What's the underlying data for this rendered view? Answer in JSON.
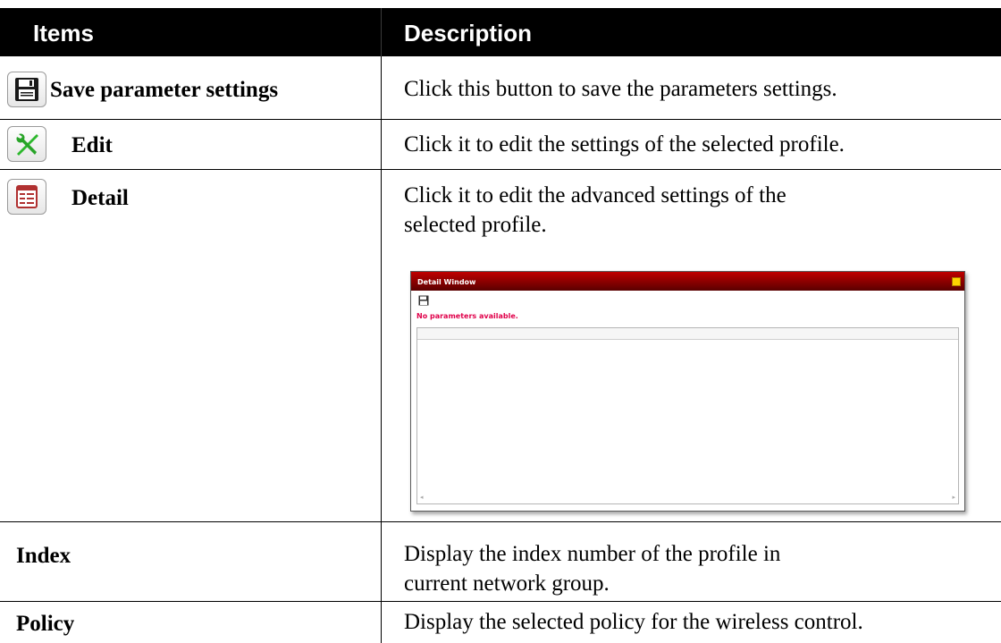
{
  "header": {
    "items": "Items",
    "description": "Description"
  },
  "rows": [
    {
      "item": "Save parameter settings",
      "icon": "floppy-disk-icon",
      "description": "Click this button to save the parameters settings."
    },
    {
      "item": "Edit",
      "icon": "wrench-screwdriver-icon",
      "description": "Click it to edit the settings of the selected profile."
    },
    {
      "item": "Detail",
      "icon": "detail-list-icon",
      "description": "Click it to edit the advanced settings of the selected profile."
    },
    {
      "item": "Index",
      "description": "Display the index number of the profile in current network group."
    },
    {
      "item": "Policy",
      "description": "Display the selected policy for the wireless control."
    }
  ],
  "detail_window": {
    "title": "Detail Window",
    "message": "No parameters available."
  },
  "colors": {
    "header_bg": "#000000",
    "window_title": "#b00000",
    "message": "#e0004a",
    "edit_icon": "#2db82d"
  }
}
